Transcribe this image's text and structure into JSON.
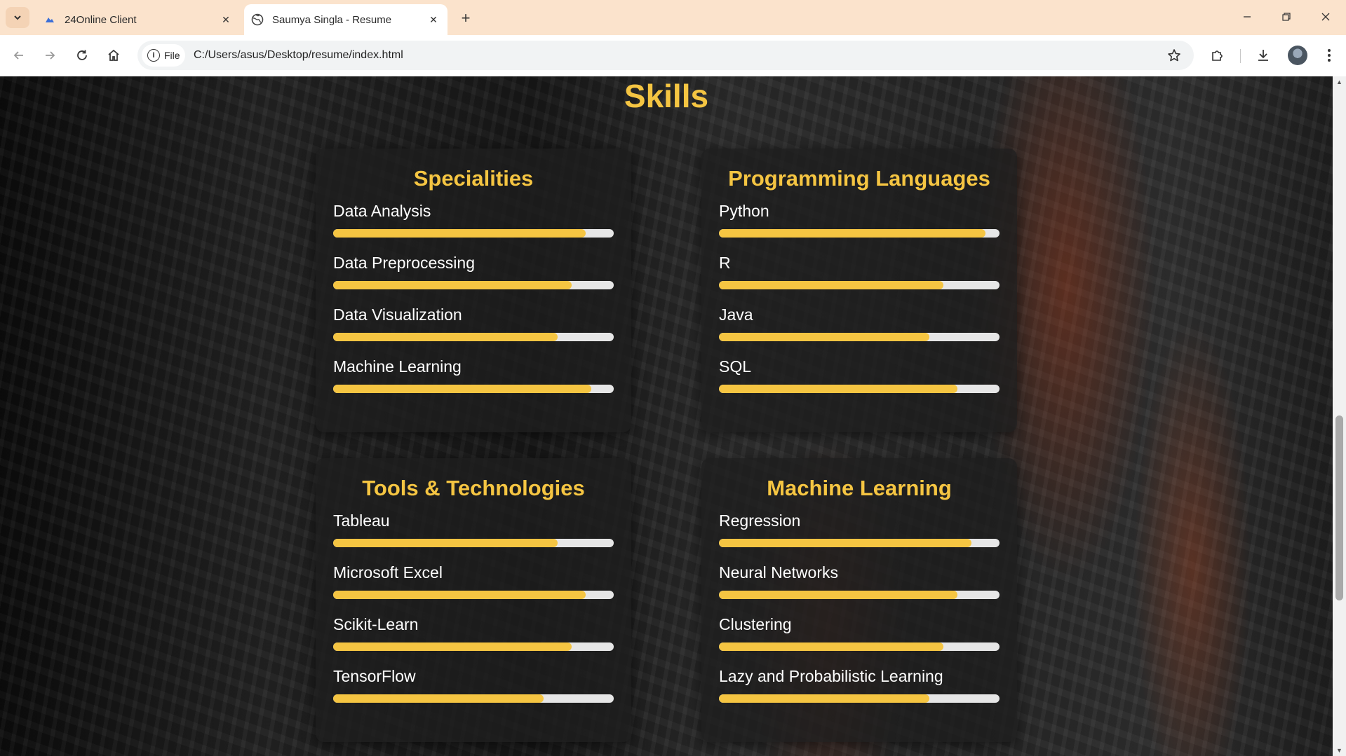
{
  "browser": {
    "tabs": [
      {
        "title": "24Online Client",
        "active": false
      },
      {
        "title": "Saumya Singla - Resume",
        "active": true
      }
    ],
    "site_chip": "File",
    "url": "C:/Users/asus/Desktop/resume/index.html"
  },
  "page": {
    "section_title": "Skills",
    "accent_color": "#f5c542",
    "cards": [
      {
        "title": "Specialities",
        "skills": [
          {
            "name": "Data Analysis",
            "level": 0.9
          },
          {
            "name": "Data Preprocessing",
            "level": 0.85
          },
          {
            "name": "Data Visualization",
            "level": 0.8
          },
          {
            "name": "Machine Learning",
            "level": 0.92
          }
        ]
      },
      {
        "title": "Programming Languages",
        "skills": [
          {
            "name": "Python",
            "level": 0.95
          },
          {
            "name": "R",
            "level": 0.8
          },
          {
            "name": "Java",
            "level": 0.75
          },
          {
            "name": "SQL",
            "level": 0.85
          }
        ]
      },
      {
        "title": "Tools & Technologies",
        "skills": [
          {
            "name": "Tableau",
            "level": 0.8
          },
          {
            "name": "Microsoft Excel",
            "level": 0.9
          },
          {
            "name": "Scikit-Learn",
            "level": 0.85
          },
          {
            "name": "TensorFlow",
            "level": 0.75
          }
        ]
      },
      {
        "title": "Machine Learning",
        "skills": [
          {
            "name": "Regression",
            "level": 0.9
          },
          {
            "name": "Neural Networks",
            "level": 0.85
          },
          {
            "name": "Clustering",
            "level": 0.8
          },
          {
            "name": "Lazy and Probabilistic Learning",
            "level": 0.75
          }
        ]
      }
    ]
  }
}
